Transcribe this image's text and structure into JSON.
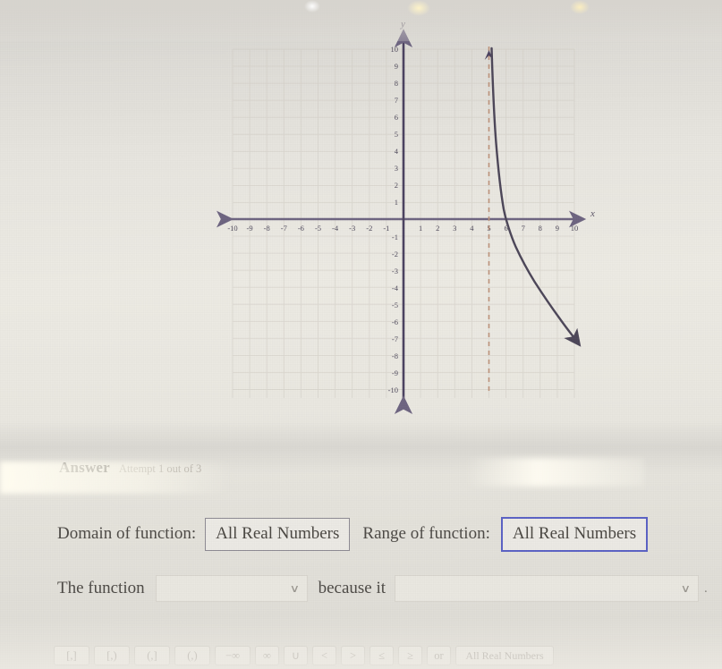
{
  "answer": {
    "title": "Answer",
    "attempt": "Attempt 1 out of 3"
  },
  "fields": {
    "domain_label": "Domain of function:",
    "domain_value": "All Real Numbers",
    "range_label": "Range of function:",
    "range_value": "All Real Numbers",
    "range_focus_color": "#5b62c4"
  },
  "statement": {
    "prefix": "The function",
    "function_select_value": "",
    "middle": "because it",
    "reason_select_value": "",
    "chevron": "∨",
    "trailing": "."
  },
  "toolbar": {
    "buttons": [
      {
        "label": "[,]",
        "name": "bracket-closed-closed-button"
      },
      {
        "label": "[,)",
        "name": "bracket-closed-open-button"
      },
      {
        "label": "(,]",
        "name": "bracket-open-closed-button"
      },
      {
        "label": "(,)",
        "name": "bracket-open-open-button"
      },
      {
        "label": "−∞",
        "name": "negative-infinity-button"
      },
      {
        "label": "∞",
        "name": "infinity-button"
      },
      {
        "label": "∪",
        "name": "union-button"
      },
      {
        "label": "<",
        "name": "less-than-button"
      },
      {
        "label": ">",
        "name": "greater-than-button"
      },
      {
        "label": "≤",
        "name": "less-than-or-equal-button"
      },
      {
        "label": "≥",
        "name": "greater-than-or-equal-button"
      },
      {
        "label": "or",
        "name": "or-button"
      },
      {
        "label": "All Real Numbers",
        "name": "all-real-numbers-button"
      }
    ]
  },
  "chart_data": {
    "type": "line",
    "title": "",
    "xlabel": "x",
    "ylabel": "y",
    "xlim": [
      -10,
      10
    ],
    "ylim": [
      -10,
      10
    ],
    "grid": true,
    "xticks": [
      -10,
      -9,
      -8,
      -7,
      -6,
      -5,
      -4,
      -3,
      -2,
      -1,
      1,
      2,
      3,
      4,
      5,
      6,
      7,
      8,
      9,
      10
    ],
    "yticks": [
      10,
      9,
      8,
      7,
      6,
      5,
      4,
      3,
      2,
      1,
      -1,
      -2,
      -3,
      -4,
      -5,
      -6,
      -7,
      -8,
      -9,
      -10
    ],
    "xtick_labels": [
      "-10",
      "-9",
      "-8",
      "-7",
      "-6",
      "-5",
      "-4",
      "-3",
      "-2",
      "-1",
      "1",
      "2",
      "3",
      "4",
      "5",
      "6",
      "7",
      "8",
      "9",
      "10"
    ],
    "ytick_labels": [
      "10",
      "9",
      "8",
      "7",
      "6",
      "5",
      "4",
      "3",
      "2",
      "1",
      "-1",
      "-2",
      "-3",
      "-4",
      "-5",
      "-6",
      "-7",
      "-8",
      "-9",
      "-10"
    ],
    "series": [
      {
        "name": "decreasing logarithmic curve",
        "color": "#4c4658",
        "description": "Decreasing logarithmic curve with vertical asymptote at x = 5, x-intercept at x = 6, arrowheads at both ends",
        "points": [
          [
            5.02,
            10.0
          ],
          [
            5.05,
            8.6
          ],
          [
            5.1,
            7.2
          ],
          [
            5.2,
            5.8
          ],
          [
            5.3,
            4.9
          ],
          [
            5.45,
            4.0
          ],
          [
            5.6,
            3.1
          ],
          [
            5.75,
            2.2
          ],
          [
            5.9,
            1.0
          ],
          [
            6.0,
            0.0
          ],
          [
            6.3,
            -1.3
          ],
          [
            6.7,
            -2.5
          ],
          [
            7.2,
            -3.7
          ],
          [
            7.8,
            -4.8
          ],
          [
            8.5,
            -5.9
          ],
          [
            9.2,
            -6.9
          ],
          [
            9.9,
            -7.8
          ]
        ]
      }
    ],
    "annotations": [
      {
        "type": "vertical-asymptote",
        "x": 5,
        "style": "dashed",
        "color": "#b78f7a",
        "label": "x = 5"
      }
    ]
  }
}
